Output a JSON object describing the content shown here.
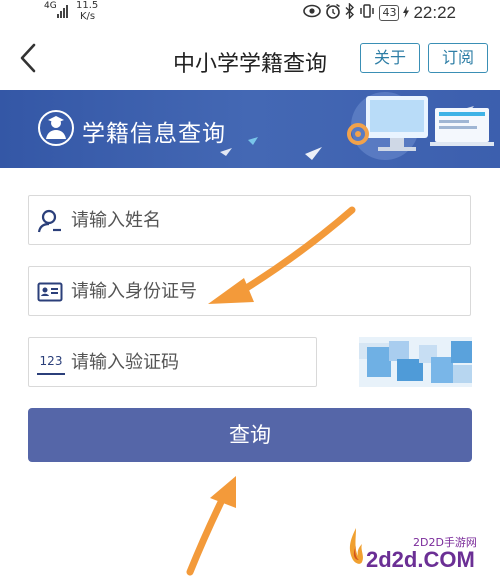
{
  "status_bar": {
    "network": "4G",
    "speed_value": "11.5",
    "speed_unit": "K/s",
    "battery": "43",
    "time": "22:22"
  },
  "header": {
    "title": "中小学学籍查询",
    "about_label": "关于",
    "subscribe_label": "订阅"
  },
  "banner": {
    "title": "学籍信息查询"
  },
  "form": {
    "name_placeholder": "请输入姓名",
    "id_placeholder": "请输入身份证号",
    "code_placeholder": "请输入验证码",
    "code_icon_text": "123",
    "submit_label": "查询"
  },
  "watermark": {
    "small_text": "2D2D手游网",
    "big_text": "2d2d.COM"
  },
  "colors": {
    "banner": "#3457a6",
    "submit_button": "#5566a8",
    "header_button_border": "#3a8fb5",
    "annotation_arrow": "#f39a3a"
  }
}
